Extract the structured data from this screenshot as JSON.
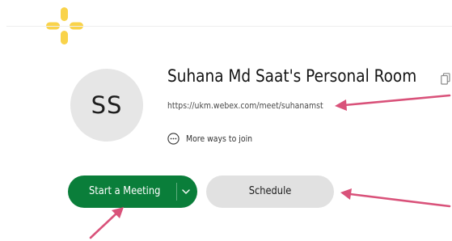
{
  "header": {
    "logo_icon": "webex-cross-logo-icon",
    "logo_color": "#f9d34a"
  },
  "room": {
    "avatar_initials": "SS",
    "title": "Suhana Md Saat's Personal Room",
    "url": "https://ukm.webex.com/meet/suhanamst",
    "copy_icon": "copy-icon",
    "more_ways_label": "More ways to join",
    "more_ways_icon": "ellipsis-circle-icon"
  },
  "actions": {
    "start_label": "Start a Meeting",
    "start_color": "#0a7e3a",
    "start_caret_icon": "chevron-down-icon",
    "schedule_label": "Schedule",
    "schedule_color": "#e1e1e1"
  },
  "annotations": {
    "arrow_color": "#d9527a"
  }
}
